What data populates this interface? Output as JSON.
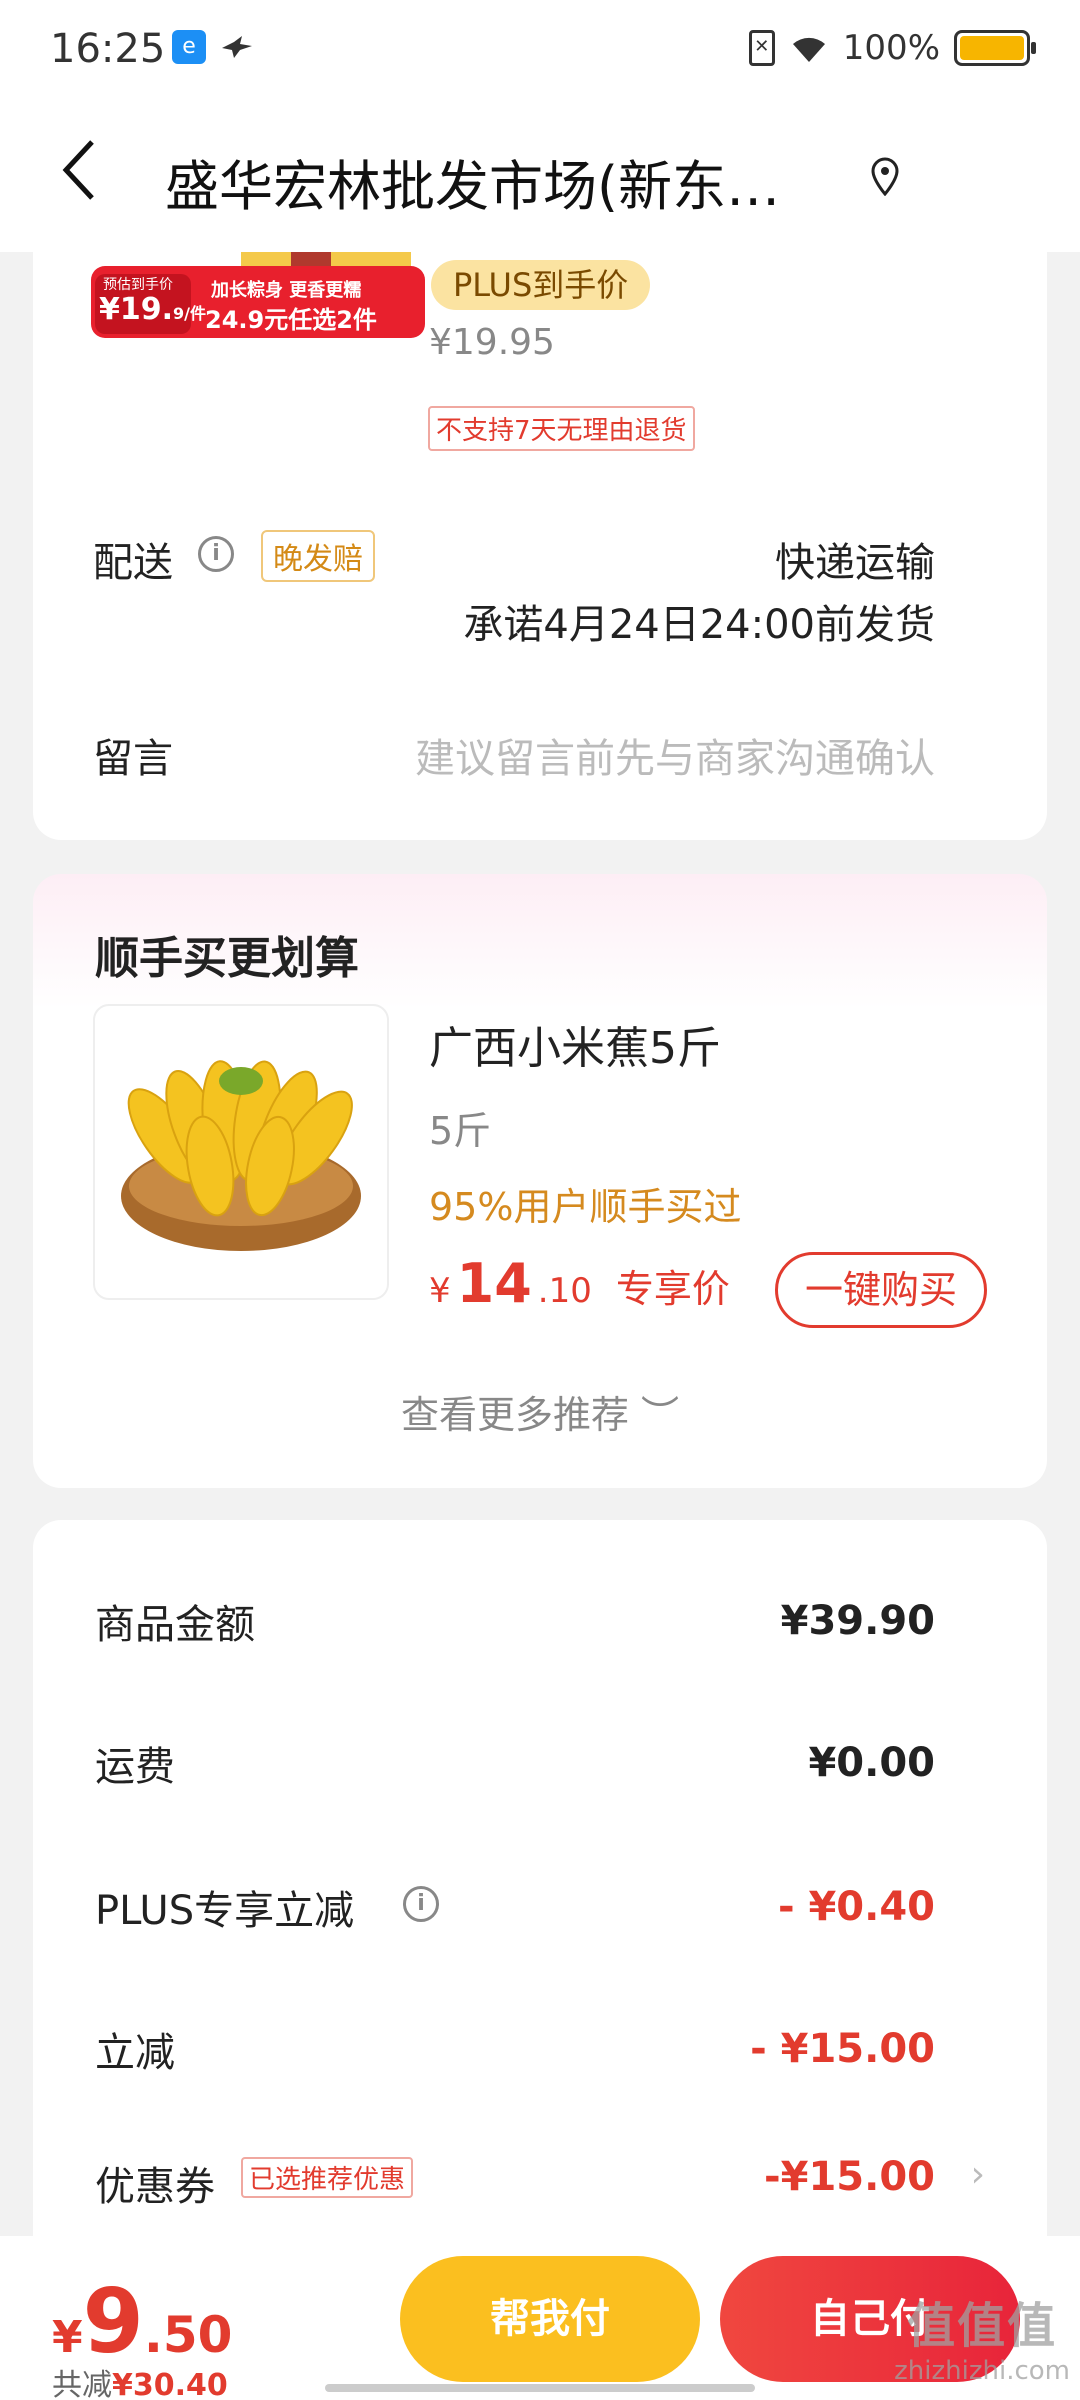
{
  "status_bar": {
    "time": "16:25",
    "battery": "100%",
    "app_icon_1": "e",
    "app_icon_2": "bird-icon"
  },
  "nav": {
    "back_icon": "‹",
    "title": "盛华宏林批发市场(新东…"
  },
  "order_item": {
    "promo_banner": {
      "label_top": "预估到手价",
      "price_big": "¥19.",
      "price_small": "9/件",
      "slogan": "加长粽身 更香更糯",
      "deal": "24.9元任选2件"
    },
    "plus_badge": "PLUS到手价",
    "plus_price": "¥19.95",
    "return_policy": "不支持7天无理由退货"
  },
  "delivery": {
    "label": "配送",
    "late_tag": "晚发赔",
    "method": "快递运输",
    "promise": "承诺4月24日24:00前发货"
  },
  "message": {
    "label": "留言",
    "placeholder": "建议留言前先与商家沟通确认"
  },
  "upsell": {
    "title": "顺手买更划算",
    "product": {
      "name": "广西小米蕉5斤",
      "spec": "5斤",
      "social": "95%用户顺手买过",
      "currency": "¥",
      "price_int": "14",
      "price_dec": ".10",
      "price_label": "专享价",
      "buy_label": "一键购买"
    },
    "more": "查看更多推荐 ︶"
  },
  "summary": {
    "rows": [
      {
        "label": "商品金额",
        "value": "¥39.90"
      },
      {
        "label": "运费",
        "value": "¥0.00"
      },
      {
        "label": "PLUS专享立减",
        "value": "- ¥0.40"
      },
      {
        "label": "立减",
        "value": "- ¥15.00"
      },
      {
        "label": "优惠券",
        "value": "-¥15.00"
      }
    ],
    "coupon_tag": "已选推荐优惠"
  },
  "bottom": {
    "currency": "¥",
    "total_int": "9",
    "total_dec": ".50",
    "saved_label": "共减",
    "saved_value": "¥30.40",
    "help_pay": "帮我付",
    "self_pay": "自己付"
  },
  "watermark": {
    "line1": "值值值",
    "line2": "zhizhizhi.com"
  },
  "colors": {
    "accent_red": "#e23b2e",
    "help_yellow": "#fbbf1f",
    "plus_gold": "#fbe3a1"
  }
}
